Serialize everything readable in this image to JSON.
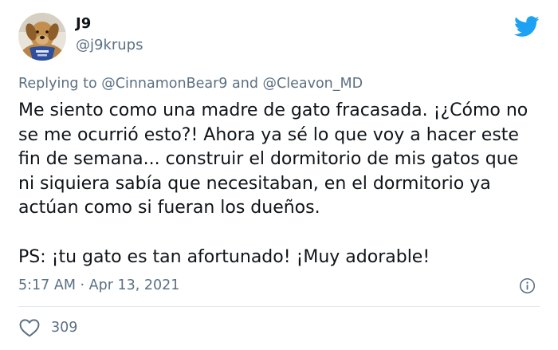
{
  "user": {
    "display_name": "J9",
    "handle": "@j9krups",
    "avatar_icon": "dog-avatar"
  },
  "reply_to": {
    "prefix": "Replying to",
    "mention_1": "@CinnamonBear9",
    "conjunction": "and",
    "mention_2": "@Cleavon_MD"
  },
  "tweet": {
    "paragraph_1": "Me siento como una madre de gato fracasada. ¡¿Cómo no se me ocurrió esto?! Ahora ya sé lo que voy a hacer este fin de semana... construir el dormitorio de mis gatos que ni siquiera sabía que necesitaban, en el dormitorio ya actúan como si fueran los dueños.",
    "paragraph_2": "PS: ¡tu gato es tan afortunado! ¡Muy adorable!"
  },
  "meta": {
    "timestamp": "5:17 AM · Apr 13, 2021"
  },
  "actions": {
    "like_count": "309",
    "like_icon": "heart-icon",
    "info_icon": "info-icon"
  },
  "colors": {
    "twitter_blue": "#1da1f2",
    "secondary_text": "#5b7083",
    "primary_text": "#0f1419"
  }
}
